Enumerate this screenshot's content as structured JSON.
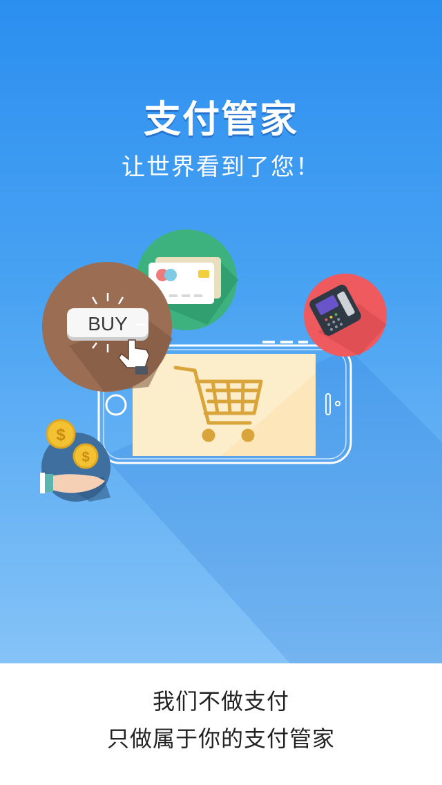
{
  "hero": {
    "title": "支付管家",
    "subtitle": "让世界看到了您！"
  },
  "illustration": {
    "buy_label": "BUY",
    "coin_symbol": "$",
    "icons": [
      "credit-card-icon",
      "pos-terminal-icon",
      "buy-button-icon",
      "coins-hand-icon",
      "shopping-cart-icon",
      "smartphone-icon"
    ]
  },
  "footer": {
    "line1": "我们不做支付",
    "line2": "只做属于你的支付管家"
  },
  "colors": {
    "hero_top": "#2b8ff0",
    "hero_bottom": "#85c3f7",
    "card_circle": "#3db27e",
    "buy_circle": "#9b6d52",
    "pos_circle": "#ee5a5e",
    "coin_circle": "#3f6f9e",
    "cart_gold": "#d9a43a"
  }
}
